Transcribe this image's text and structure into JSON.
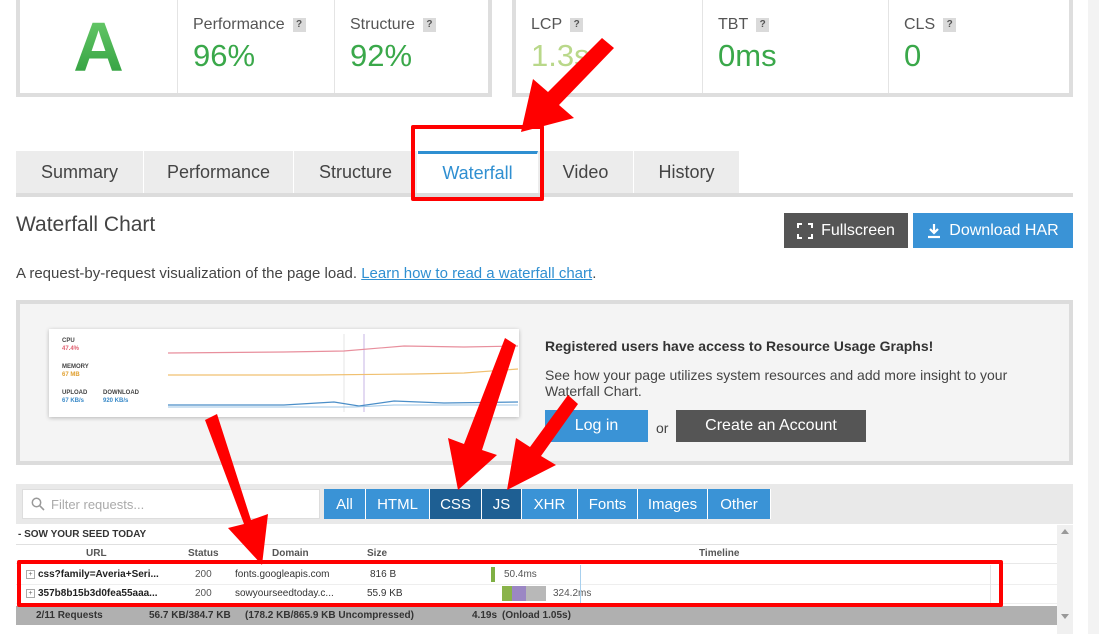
{
  "grade": "A",
  "metrics": {
    "performance": {
      "label": "Performance",
      "value": "96%"
    },
    "structure": {
      "label": "Structure",
      "value": "92%"
    },
    "lcp": {
      "label": "LCP",
      "value": "1.3s"
    },
    "tbt": {
      "label": "TBT",
      "value": "0ms"
    },
    "cls": {
      "label": "CLS",
      "value": "0"
    },
    "help": "?"
  },
  "tabs": [
    "Summary",
    "Performance",
    "Structure",
    "Waterfall",
    "Video",
    "History"
  ],
  "page": {
    "title": "Waterfall Chart",
    "fullscreen": "Fullscreen",
    "download": "Download HAR",
    "description": "A request-by-request visualization of the page load.",
    "link": "Learn how to read a waterfall chart",
    "period": "."
  },
  "register": {
    "heading": "Registered users have access to Resource Usage Graphs!",
    "body": "See how your page utilizes system resources and add more insight to your Waterfall Chart.",
    "login": "Log in",
    "or": "or",
    "create": "Create an Account",
    "graph": {
      "cpu": "CPU",
      "cpu_val": "47.4%",
      "memory": "MEMORY",
      "memory_val": "67 MB",
      "upload": "UPLOAD",
      "upload_val": "67 KB/s",
      "download": "DOWNLOAD",
      "download_val": "920 KB/s"
    }
  },
  "filter": {
    "placeholder": "Filter requests...",
    "buttons": [
      "All",
      "HTML",
      "CSS",
      "JS",
      "XHR",
      "Fonts",
      "Images",
      "Other"
    ],
    "active": [
      "CSS",
      "JS"
    ]
  },
  "waterfall": {
    "group": "- SOW YOUR SEED TODAY",
    "headers": {
      "url": "URL",
      "status": "Status",
      "domain": "Domain",
      "size": "Size",
      "timeline": "Timeline"
    },
    "rows": [
      {
        "url": "css?family=Averia+Seri...",
        "status": "200",
        "domain": "fonts.googleapis.com",
        "size": "816 B",
        "time": "50.4ms"
      },
      {
        "url": "357b8b15b3d0fea55aaa...",
        "status": "200",
        "domain": "sowyourseedtoday.c...",
        "size": "55.9 KB",
        "time": "324.2ms"
      }
    ],
    "footer": {
      "requests": "2/11 Requests",
      "size": "56.7 KB/384.7 KB",
      "uncompressed": "(178.2 KB/865.9 KB Uncompressed)",
      "time": "4.19s",
      "onload": "(Onload 1.05s)"
    }
  },
  "colors": {
    "accent": "#2f8fd1",
    "grade": "#2e9e3e",
    "annotation": "#ff0000",
    "dark_button": "#555555"
  }
}
